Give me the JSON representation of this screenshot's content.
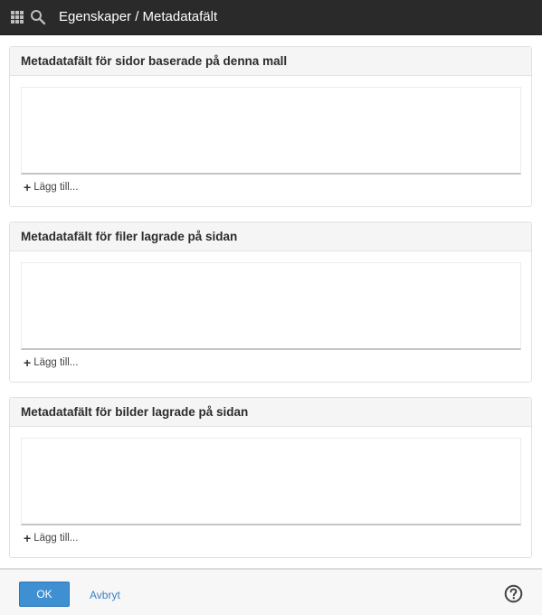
{
  "header": {
    "title": "Egenskaper / Metadatafält",
    "apps_icon": "apps-grid-icon",
    "search_icon": "search-icon"
  },
  "panels": [
    {
      "title": "Metadatafält för sidor baserade på denna mall",
      "add_label": "Lägg till..."
    },
    {
      "title": "Metadatafält för filer lagrade på sidan",
      "add_label": "Lägg till..."
    },
    {
      "title": "Metadatafält för bilder lagrade på sidan",
      "add_label": "Lägg till..."
    }
  ],
  "footer": {
    "ok_label": "OK",
    "cancel_label": "Avbryt",
    "help_icon": "help-icon"
  },
  "colors": {
    "topbar": "#2a2a2a",
    "primary_button": "#3f8fd3",
    "link": "#3a80c4"
  }
}
